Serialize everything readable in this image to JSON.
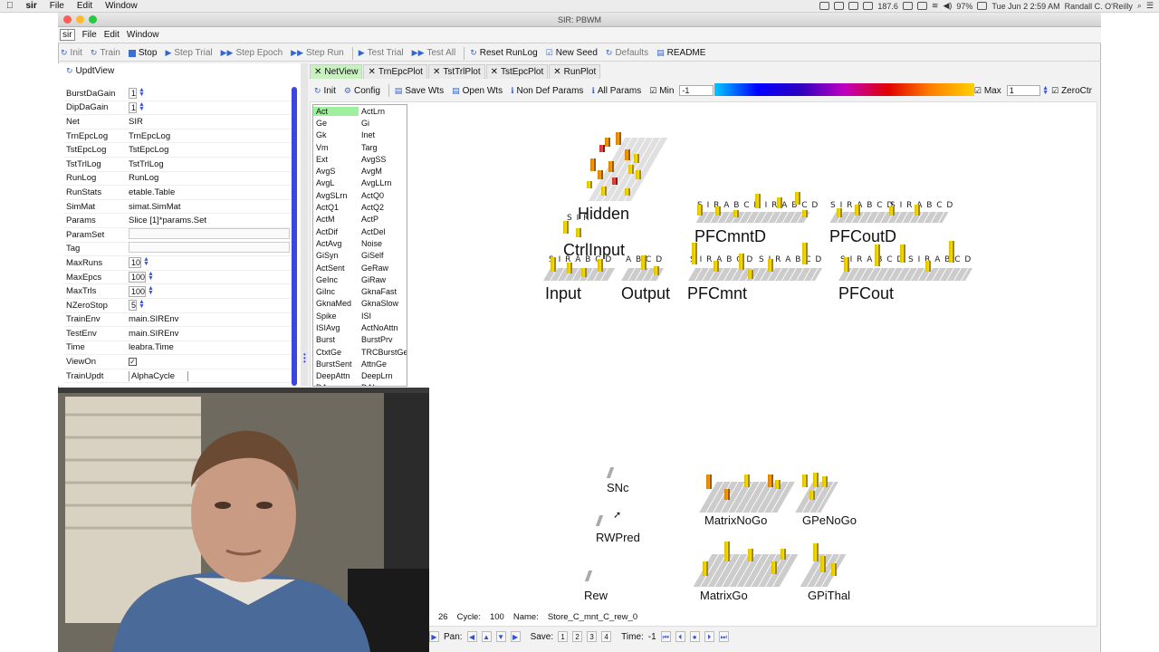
{
  "macos": {
    "app": "sir",
    "menus": [
      "File",
      "Edit",
      "Window"
    ],
    "battery": "97%",
    "datetime": "Tue Jun 2  2:59 AM",
    "user": "Randall C. O'Reilly",
    "netspeed": "187.6"
  },
  "window": {
    "title": "SIR: PBWM"
  },
  "appmenu": {
    "sir": "sir",
    "items": [
      "File",
      "Edit",
      "Window"
    ]
  },
  "toolbar": [
    {
      "label": "Init",
      "glyph": "↻",
      "on": false
    },
    {
      "label": "Train",
      "glyph": "↻",
      "on": false
    },
    {
      "label": "Stop",
      "glyph": "",
      "on": true,
      "stop": true
    },
    {
      "label": "Step Trial",
      "glyph": "▶",
      "on": false
    },
    {
      "label": "Step Epoch",
      "glyph": "▶▶",
      "on": false
    },
    {
      "label": "Step Run",
      "glyph": "▶▶",
      "on": false
    },
    {
      "label": "Test Trial",
      "glyph": "▶",
      "on": false
    },
    {
      "label": "Test All",
      "glyph": "▶▶",
      "on": false
    },
    {
      "label": "Reset RunLog",
      "glyph": "↻",
      "on": true
    },
    {
      "label": "New Seed",
      "glyph": "☑",
      "on": true
    },
    {
      "label": "Defaults",
      "glyph": "↻",
      "on": false
    },
    {
      "label": "README",
      "glyph": "▤",
      "on": true
    }
  ],
  "updtview": {
    "label": "UpdtView"
  },
  "props": [
    {
      "k": "BurstDaGain",
      "v": "1",
      "type": "num"
    },
    {
      "k": "DipDaGain",
      "v": "1",
      "type": "num"
    },
    {
      "k": "Net",
      "v": "SIR",
      "type": "text"
    },
    {
      "k": "TrnEpcLog",
      "v": "TrnEpcLog",
      "type": "text"
    },
    {
      "k": "TstEpcLog",
      "v": "TstEpcLog",
      "type": "text"
    },
    {
      "k": "TstTrlLog",
      "v": "TstTrlLog",
      "type": "text"
    },
    {
      "k": "RunLog",
      "v": "RunLog",
      "type": "text"
    },
    {
      "k": "RunStats",
      "v": "etable.Table",
      "type": "text"
    },
    {
      "k": "SimMat",
      "v": "simat.SimMat",
      "type": "text"
    },
    {
      "k": "Params",
      "v": "Slice [1]*params.Set",
      "type": "text"
    },
    {
      "k": "ParamSet",
      "v": "",
      "type": "field"
    },
    {
      "k": "Tag",
      "v": "",
      "type": "field"
    },
    {
      "k": "MaxRuns",
      "v": "10",
      "type": "num"
    },
    {
      "k": "MaxEpcs",
      "v": "100",
      "type": "num"
    },
    {
      "k": "MaxTrls",
      "v": "100",
      "type": "num"
    },
    {
      "k": "NZeroStop",
      "v": "5",
      "type": "num"
    },
    {
      "k": "TrainEnv",
      "v": "main.SIREnv",
      "type": "text"
    },
    {
      "k": "TestEnv",
      "v": "main.SIREnv",
      "type": "text"
    },
    {
      "k": "Time",
      "v": "leabra.Time",
      "type": "text"
    },
    {
      "k": "ViewOn",
      "v": "✓",
      "type": "check"
    },
    {
      "k": "TrainUpdt",
      "v": "AlphaCycle",
      "type": "text"
    }
  ],
  "tabs": [
    {
      "label": "NetView",
      "active": true
    },
    {
      "label": "TrnEpcPlot"
    },
    {
      "label": "TstTrlPlot"
    },
    {
      "label": "TstEpcPlot"
    },
    {
      "label": "RunPlot"
    }
  ],
  "nettoolbar": {
    "init": "Init",
    "config": "Config",
    "savewts": "Save Wts",
    "openwts": "Open Wts",
    "nondef": "Non Def Params",
    "allparams": "All Params",
    "min_label": "Min",
    "min_val": "-1",
    "max_label": "Max",
    "max_val": "1",
    "zeroctr": "ZeroCtr"
  },
  "vars": [
    [
      "Act",
      "ActLrn"
    ],
    [
      "Ge",
      "Gi"
    ],
    [
      "Gk",
      "Inet"
    ],
    [
      "Vm",
      "Targ"
    ],
    [
      "Ext",
      "AvgSS"
    ],
    [
      "AvgS",
      "AvgM"
    ],
    [
      "AvgL",
      "AvgLLrn"
    ],
    [
      "AvgSLrn",
      "ActQ0"
    ],
    [
      "ActQ1",
      "ActQ2"
    ],
    [
      "ActM",
      "ActP"
    ],
    [
      "ActDif",
      "ActDel"
    ],
    [
      "ActAvg",
      "Noise"
    ],
    [
      "GiSyn",
      "GiSelf"
    ],
    [
      "ActSent",
      "GeRaw"
    ],
    [
      "GeInc",
      "GiRaw"
    ],
    [
      "GiInc",
      "GknaFast"
    ],
    [
      "GknaMed",
      "GknaSlow"
    ],
    [
      "Spike",
      "ISI"
    ],
    [
      "ISIAvg",
      "ActNoAttn"
    ],
    [
      "Burst",
      "BurstPrv"
    ],
    [
      "CtxtGe",
      "TRCBurstGe"
    ],
    [
      "BurstSent",
      "AttnGe"
    ],
    [
      "DeepAttn",
      "DeepLrn"
    ],
    [
      "DA",
      "DALrn"
    ]
  ],
  "layers": {
    "hidden": "Hidden",
    "ctrlinput": "CtrlInput",
    "pfcmntd": "PFCmntD",
    "pfcoutd": "PFCoutD",
    "input": "Input",
    "output": "Output",
    "pfcmnt": "PFCmnt",
    "pfcout": "PFCout",
    "snc": "SNc",
    "rwpred": "RWPred",
    "rew": "Rew",
    "matrixnogo": "MatrixNoGo",
    "gpenogo": "GPeNoGo",
    "matrixgo": "MatrixGo",
    "gpithal": "GPiThal"
  },
  "unitletters": {
    "full": "S I R A B C D",
    "abcd": "A B C D",
    "sir": "S I R"
  },
  "status": {
    "trial": "26",
    "cycle_label": "Cycle:",
    "cycle": "100",
    "name_label": "Name:",
    "name": "Store_C_mnt_C_rew_0"
  },
  "navbar": {
    "pan": "Pan:",
    "save": "Save:",
    "slots": [
      "1",
      "2",
      "3",
      "4"
    ],
    "time": "Time:",
    "time_val": "-1"
  }
}
